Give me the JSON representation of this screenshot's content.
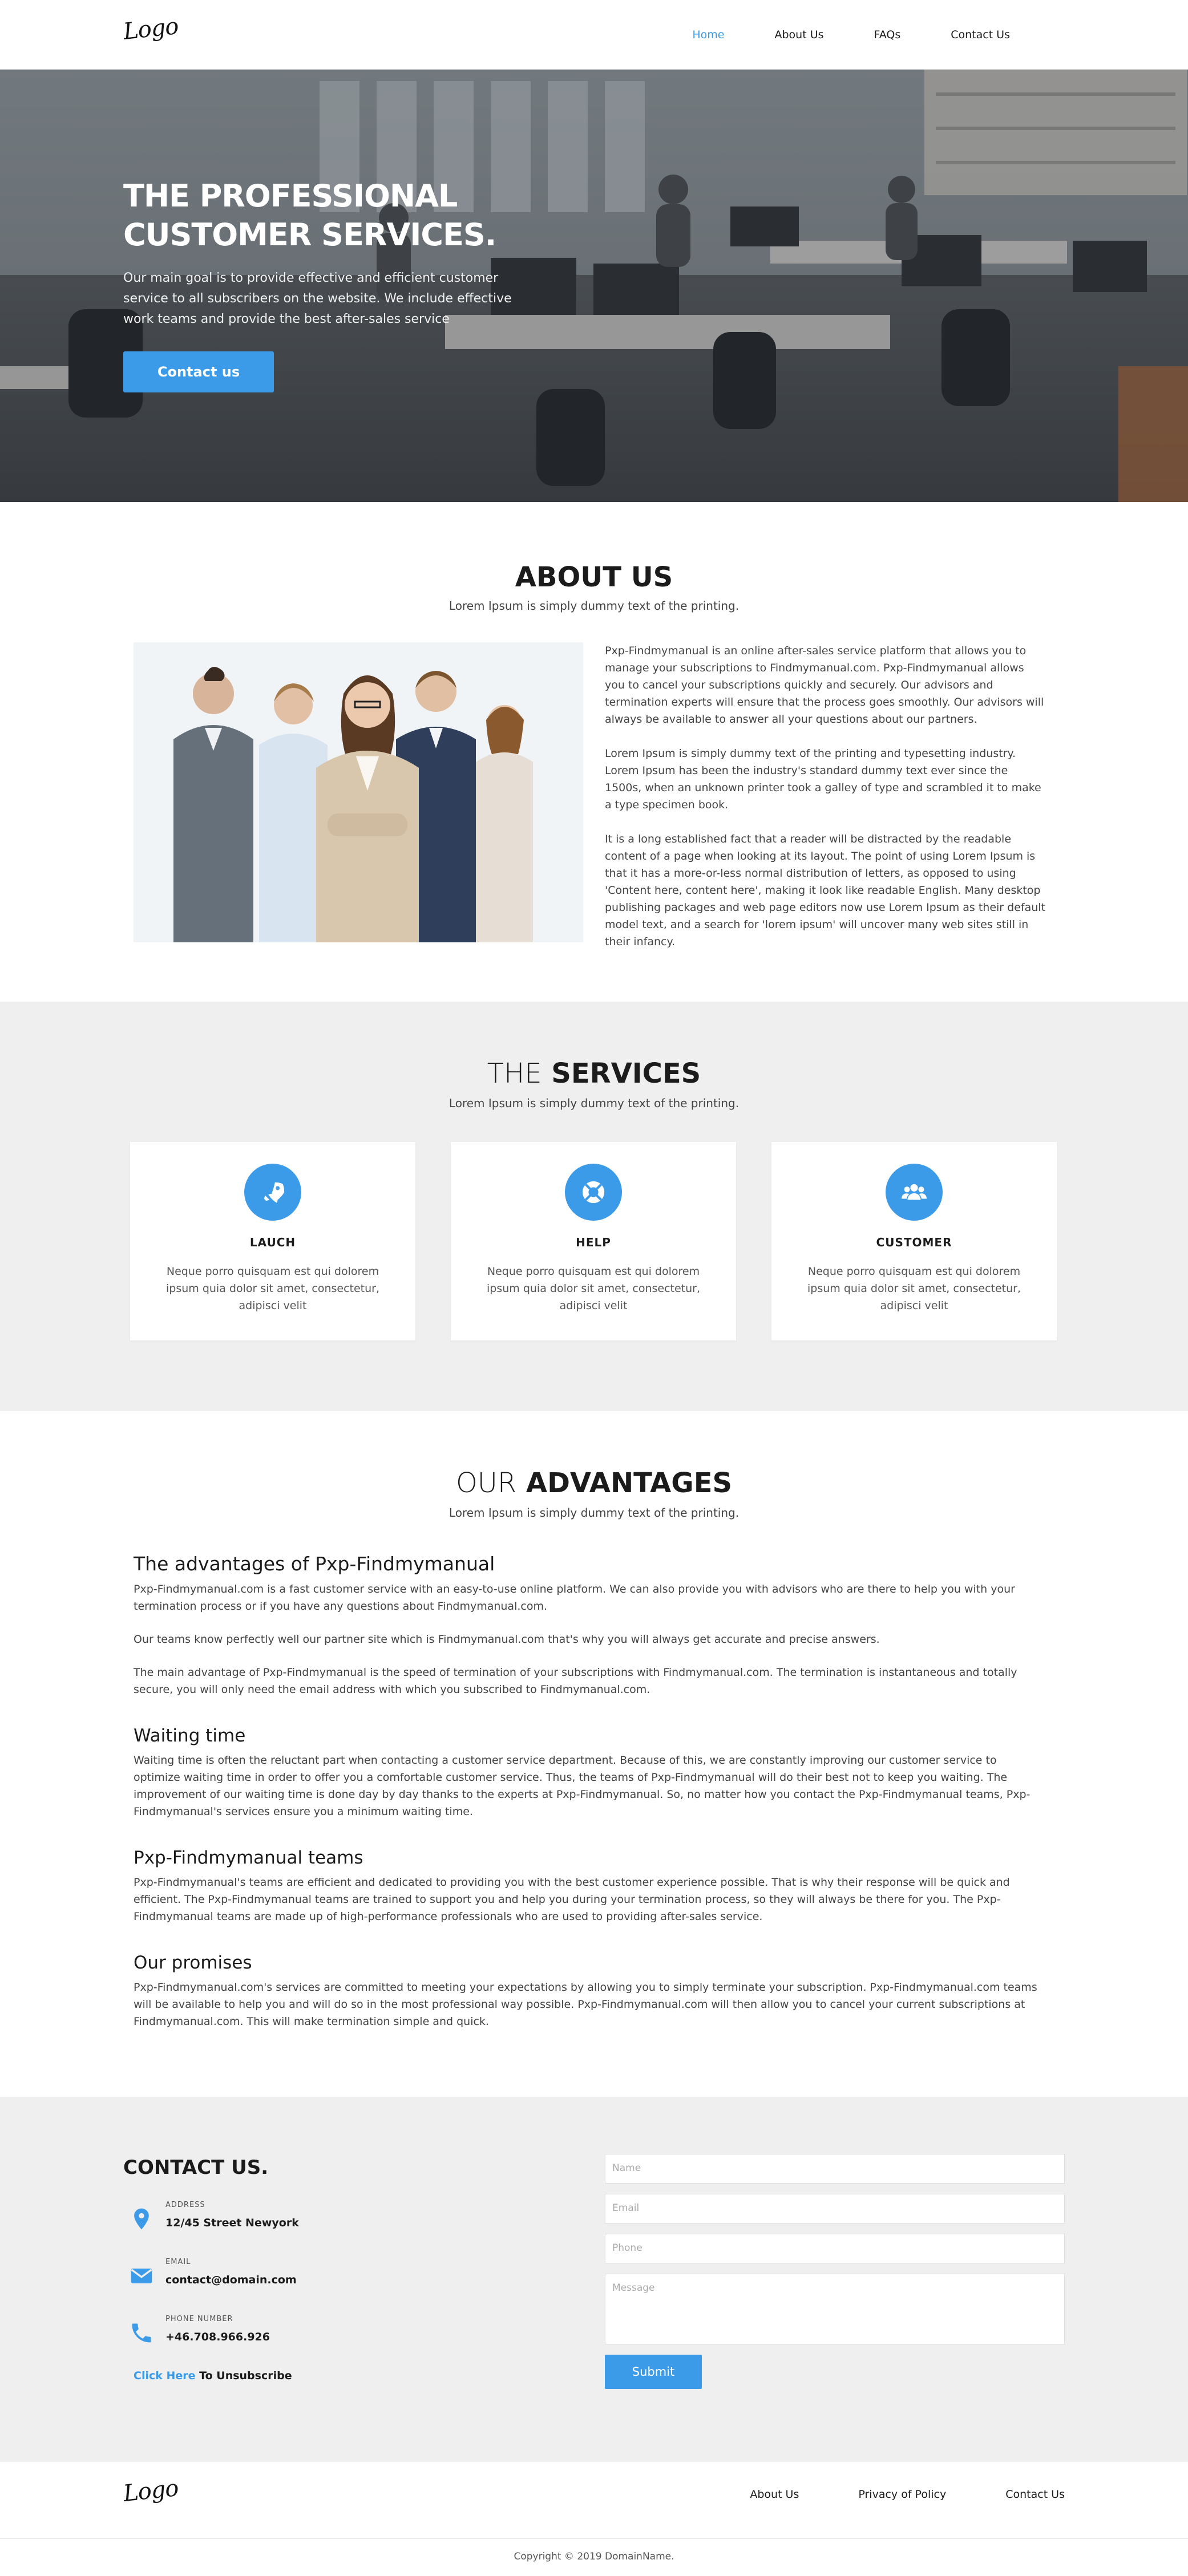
{
  "nav": {
    "logo": "Logo",
    "links": [
      "Home",
      "About Us",
      "FAQs",
      "Contact Us"
    ],
    "active": "Home"
  },
  "hero": {
    "title_line1": "THE PROFESSIONAL",
    "title_line2": "CUSTOMER SERVICES.",
    "text": "Our main goal is to provide effective and efficient customer service to all subscribers on the website. We include effective work teams and provide the best after-sales service",
    "button": "Contact us"
  },
  "about": {
    "title": "ABOUT US",
    "subtitle": "Lorem Ipsum is simply dummy text of the printing.",
    "paragraphs": [
      "Pxp-Findmymanual is an online after-sales service platform that allows you to manage your subscriptions to Findmymanual.com. Pxp-Findmymanual allows you to cancel your subscriptions quickly and securely. Our advisors and termination experts will ensure that the process goes smoothly. Our advisors will always be available to answer all your questions about our partners.",
      "Lorem Ipsum is simply dummy text of the printing and typesetting industry. Lorem Ipsum has been the industry's standard dummy text ever since the 1500s, when an unknown printer took a galley of type and scrambled it to make a type specimen book.",
      "It is a long established fact that a reader will be distracted by the readable content of a page when looking at its layout. The point of using Lorem Ipsum is that it has a more-or-less normal distribution of letters, as opposed to using 'Content here, content here', making it look like readable English. Many desktop publishing packages and web page editors now use Lorem Ipsum as their default model text, and a search for 'lorem ipsum' will uncover many web sites still in their infancy."
    ]
  },
  "services": {
    "title_light": "THE",
    "title_bold": "SERVICES",
    "subtitle": "Lorem Ipsum is simply dummy text of the printing.",
    "cards": [
      {
        "icon": "rocket-icon",
        "title": "LAUCH",
        "text": "Neque porro quisquam est qui dolorem ipsum quia dolor sit amet, consectetur, adipisci velit"
      },
      {
        "icon": "lifebuoy-icon",
        "title": "HELP",
        "text": "Neque porro quisquam est qui dolorem ipsum quia dolor sit amet, consectetur, adipisci velit"
      },
      {
        "icon": "users-icon",
        "title": "CUSTOMER",
        "text": "Neque porro quisquam est qui dolorem ipsum quia dolor sit amet, consectetur, adipisci velit"
      }
    ]
  },
  "advantages": {
    "title_light": "OUR",
    "title_bold": "ADVANTAGES",
    "subtitle": "Lorem Ipsum is simply dummy text of the printing.",
    "blocks": [
      {
        "heading": "The advantages of Pxp-Findmymanual",
        "paragraphs": [
          "Pxp-Findmymanual.com is a fast customer service with an easy-to-use online platform. We can also provide you with advisors who are there to help you with your termination process or if you have any questions about Findmymanual.com.",
          "Our teams know perfectly well our partner site which is Findmymanual.com that's why you will always get accurate and precise answers.",
          "The main advantage of Pxp-Findmymanual is the speed of termination of your subscriptions with Findmymanual.com. The termination is instantaneous and totally secure, you will only need the email address with which you subscribed to Findmymanual.com."
        ]
      },
      {
        "heading": "Waiting time",
        "paragraphs": [
          "Waiting time is often the reluctant part when contacting a customer service department. Because of this, we are constantly improving our customer service to optimize waiting time in order to offer you a comfortable customer service. Thus, the teams of Pxp-Findmymanual will do their best not to keep you waiting. The improvement of our waiting time is done day by day thanks to the experts at Pxp-Findmymanual. So, no matter how you contact the Pxp-Findmymanual teams, Pxp-Findmymanual's services ensure you a minimum waiting time."
        ]
      },
      {
        "heading": "Pxp-Findmymanual teams",
        "paragraphs": [
          "Pxp-Findmymanual's teams are efficient and dedicated to providing you with the best customer experience possible. That is why their response will be quick and efficient. The Pxp-Findmymanual teams are trained to support you and help you during your termination process, so they will always be there for you. The Pxp-Findmymanual teams are made up of high-performance professionals who are used to providing after-sales service."
        ]
      },
      {
        "heading": "Our promises",
        "paragraphs": [
          "Pxp-Findmymanual.com's services are committed to meeting your expectations by allowing you to simply terminate your subscription. Pxp-Findmymanual.com teams will be available to help you and will do so in the most professional way possible. Pxp-Findmymanual.com will then allow you to cancel your current subscriptions at Findmymanual.com. This will make termination simple and quick."
        ]
      }
    ]
  },
  "contact": {
    "title": "CONTACT US.",
    "items": [
      {
        "icon": "map-pin-icon",
        "label": "ADDRESS",
        "value": "12/45 Street Newyork"
      },
      {
        "icon": "envelope-icon",
        "label": "EMAIL",
        "value": "contact@domain.com"
      },
      {
        "icon": "phone-icon",
        "label": "PHONE NUMBER",
        "value": "+46.708.966.926"
      }
    ],
    "unsubscribe_link": "Click Here",
    "unsubscribe_text": "To Unsubscribe",
    "form": {
      "name_placeholder": "Name",
      "email_placeholder": "Email",
      "phone_placeholder": "Phone",
      "message_placeholder": "Message",
      "submit": "Submit"
    }
  },
  "footer": {
    "logo": "Logo",
    "links": [
      "About Us",
      "Privacy of Policy",
      "Contact Us"
    ],
    "copyright": "Copyright © 2019 DomainName."
  },
  "colors": {
    "accent": "#3b9be8",
    "section_gray": "#efefef",
    "text_dark": "#1b1b1b"
  }
}
